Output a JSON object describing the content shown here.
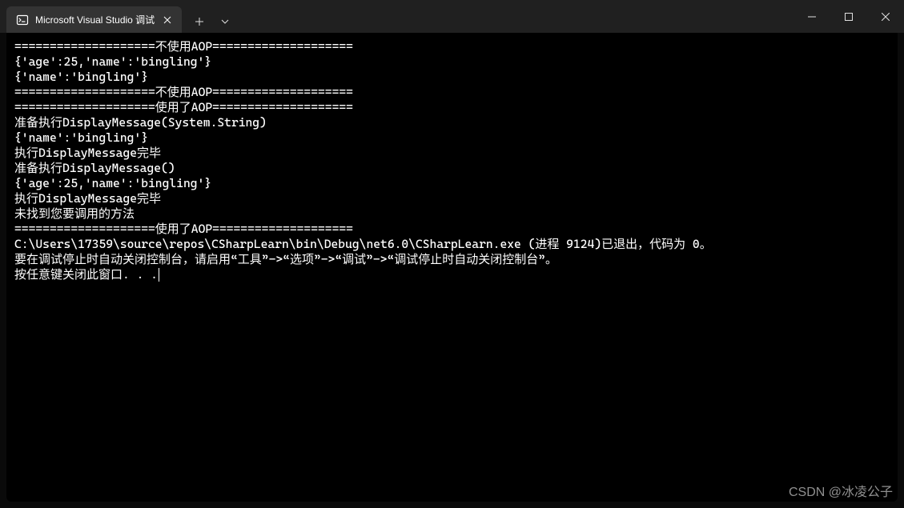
{
  "tab": {
    "title": "Microsoft Visual Studio 调试"
  },
  "console": {
    "lines": [
      "====================不使用AOP====================",
      "{'age':25,'name':'bingling'}",
      "",
      "{'name':'bingling'}",
      "====================不使用AOP====================",
      "",
      "====================使用了AOP====================",
      "准备执行DisplayMessage(System.String)",
      "{'name':'bingling'}",
      "执行DisplayMessage完毕",
      "",
      "准备执行DisplayMessage()",
      "{'age':25,'name':'bingling'}",
      "执行DisplayMessage完毕",
      "",
      "未找到您要调用的方法",
      "",
      "====================使用了AOP====================",
      "",
      "C:\\Users\\17359\\source\\repos\\CSharpLearn\\bin\\Debug\\net6.0\\CSharpLearn.exe (进程 9124)已退出，代码为 0。",
      "要在调试停止时自动关闭控制台，请启用“工具”->“选项”->“调试”->“调试停止时自动关闭控制台”。",
      "按任意键关闭此窗口. . ."
    ]
  },
  "watermark": "CSDN @冰凌公子"
}
